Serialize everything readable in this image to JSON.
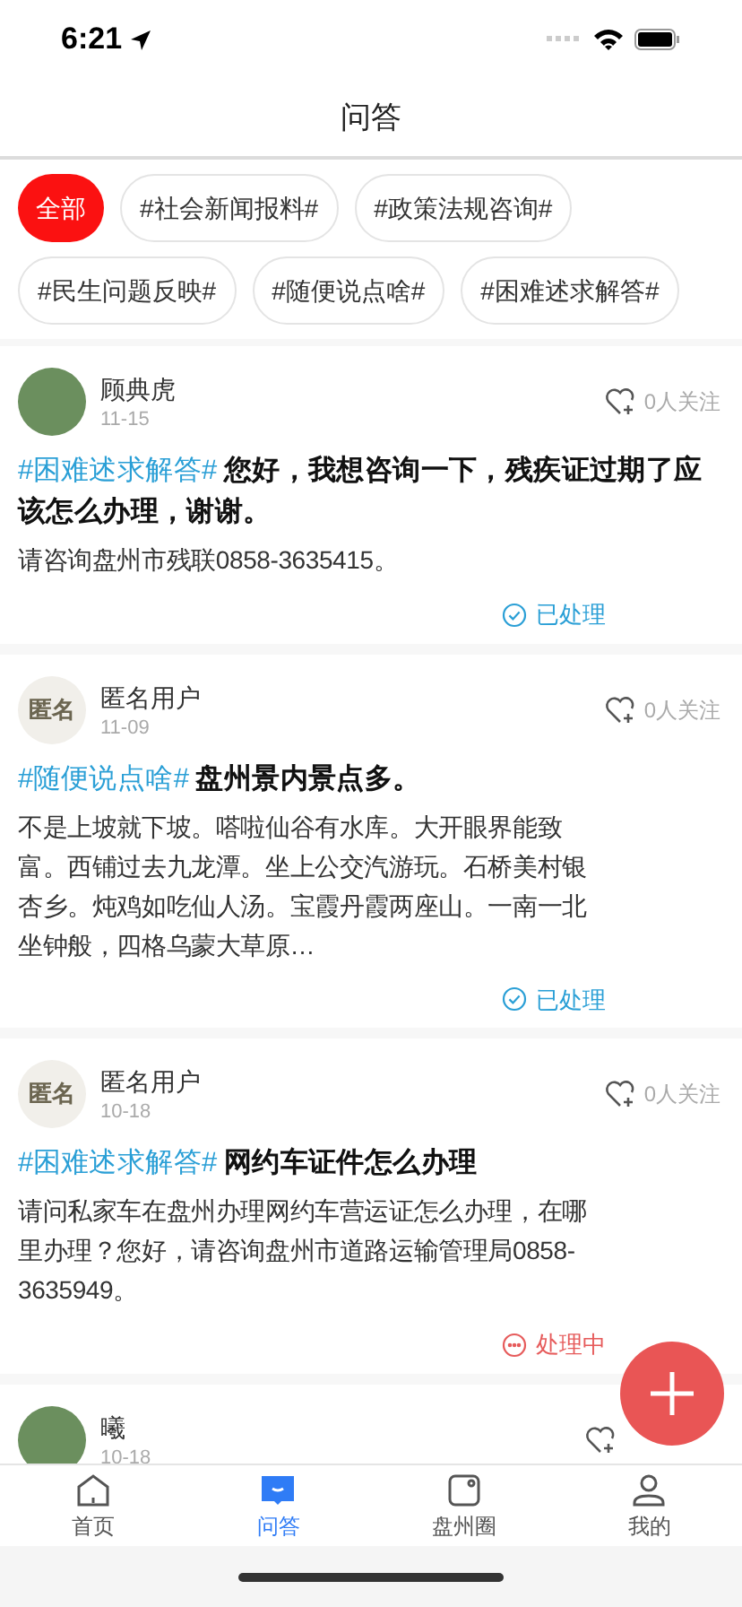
{
  "status_bar": {
    "time": "6:21"
  },
  "header": {
    "title": "问答"
  },
  "topics": [
    {
      "label": "全部",
      "selected": true
    },
    {
      "label": "#社会新闻报料#",
      "selected": false
    },
    {
      "label": "#政策法规咨询#",
      "selected": false
    },
    {
      "label": "#民生问题反映#",
      "selected": false
    },
    {
      "label": "#随便说点啥#",
      "selected": false
    },
    {
      "label": "#困难述求解答#",
      "selected": false
    }
  ],
  "posts": [
    {
      "avatar": {
        "kind": "photo"
      },
      "author": "顾典虎",
      "date": "11-15",
      "follow": "0人关注",
      "topic": "#困难述求解答#",
      "title": "您好，我想咨询一下，残疾证过期了应该怎么办理，谢谢。",
      "body": "请咨询盘州市残联0858-3635415。",
      "status": {
        "kind": "done",
        "label": "已处理"
      }
    },
    {
      "avatar": {
        "kind": "anonymous",
        "text": "匿名"
      },
      "author": "匿名用户",
      "date": "11-09",
      "follow": "0人关注",
      "topic": "#随便说点啥#",
      "title": "盘州景内景点多。",
      "body": "不是上坡就下坡。嗒啦仙谷有水库。大开眼界能致富。西铺过去九龙潭。坐上公交汽游玩。石桥美村银杏乡。炖鸡如吃仙人汤。宝霞丹霞两座山。一南一北坐钟般，四格乌蒙大草原…",
      "status": {
        "kind": "done",
        "label": "已处理"
      }
    },
    {
      "avatar": {
        "kind": "anonymous",
        "text": "匿名"
      },
      "author": "匿名用户",
      "date": "10-18",
      "follow": "0人关注",
      "topic": "#困难述求解答#",
      "title": "网约车证件怎么办理",
      "body": "请问私家车在盘州办理网约车营运证怎么办理，在哪里办理？您好，请咨询盘州市道路运输管理局0858-3635949。",
      "status": {
        "kind": "pending",
        "label": "处理中"
      }
    },
    {
      "avatar": {
        "kind": "photo"
      },
      "author": "曦",
      "date": "10-18"
    }
  ],
  "tab_bar": [
    {
      "label": "首页",
      "selected": false
    },
    {
      "label": "问答",
      "selected": true
    },
    {
      "label": "盘州圈",
      "selected": false
    },
    {
      "label": "我的",
      "selected": false
    }
  ]
}
